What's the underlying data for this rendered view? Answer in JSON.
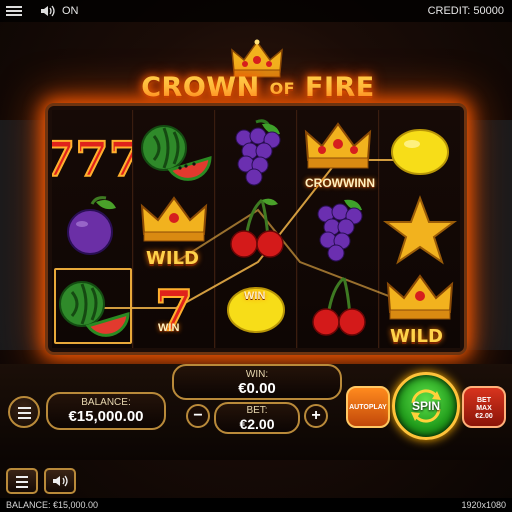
{
  "topbar": {
    "sound_label": "ON",
    "credit": "CREDIT: 50000"
  },
  "game": {
    "title_left": "CROWN",
    "title_of": "OF",
    "title_right": "FIRE"
  },
  "reels": {
    "labels": {
      "wild": "WILD",
      "crownwin": "CROWWINN",
      "win": "WIN"
    }
  },
  "controls": {
    "balance_label": "BALANCE:",
    "balance_value": "€15,000.00",
    "win_label": "WIN:",
    "win_value": "€0.00",
    "bet_label": "BET:",
    "bet_value": "€2.00",
    "minus": "−",
    "plus": "+",
    "autoplay": "AUTOPLAY",
    "spin": "SPIN",
    "betmax_line1": "BET",
    "betmax_line2": "MAX",
    "betmax_line3": "€2.00"
  },
  "footer": {
    "balance": "BALANCE: €15,000.00",
    "resolution": "1920x1080"
  },
  "colors": {
    "accent": "#ffd24a",
    "fire": "#ff5a00",
    "spin": "#1f9a1a",
    "gold_border": "#b98a3a"
  }
}
